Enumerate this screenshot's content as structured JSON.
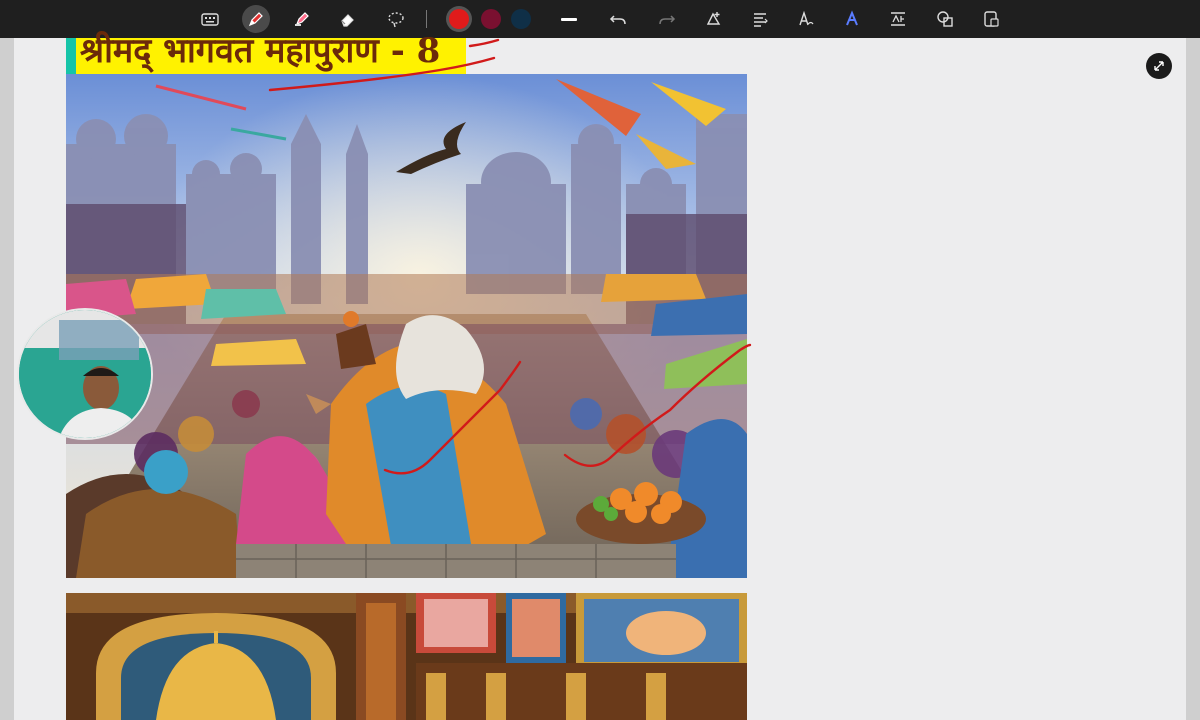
{
  "toolbar": {
    "tools": [
      {
        "name": "keyboard-icon"
      },
      {
        "name": "pen-icon"
      },
      {
        "name": "highlighter-icon"
      },
      {
        "name": "eraser-icon"
      },
      {
        "name": "lasso-select-icon"
      },
      {
        "name": "undo-icon"
      },
      {
        "name": "redo-icon"
      },
      {
        "name": "add-shape-icon"
      },
      {
        "name": "align-text-icon"
      },
      {
        "name": "text-to-ink-icon"
      },
      {
        "name": "ink-to-shape-icon"
      },
      {
        "name": "math-icon"
      },
      {
        "name": "shapes-icon"
      },
      {
        "name": "ruler-icon"
      }
    ],
    "active_tool": "pen",
    "colors": [
      "#e01b1b",
      "#7a1030",
      "#0f2f47"
    ],
    "selected_color": "#e01b1b"
  },
  "page": {
    "title": "श्रीमद् भागवत महापुराण - 8",
    "title_highlight": "#fff200",
    "title_color": "#6b2a0a"
  },
  "ink": {
    "color": "#d11a1a"
  }
}
